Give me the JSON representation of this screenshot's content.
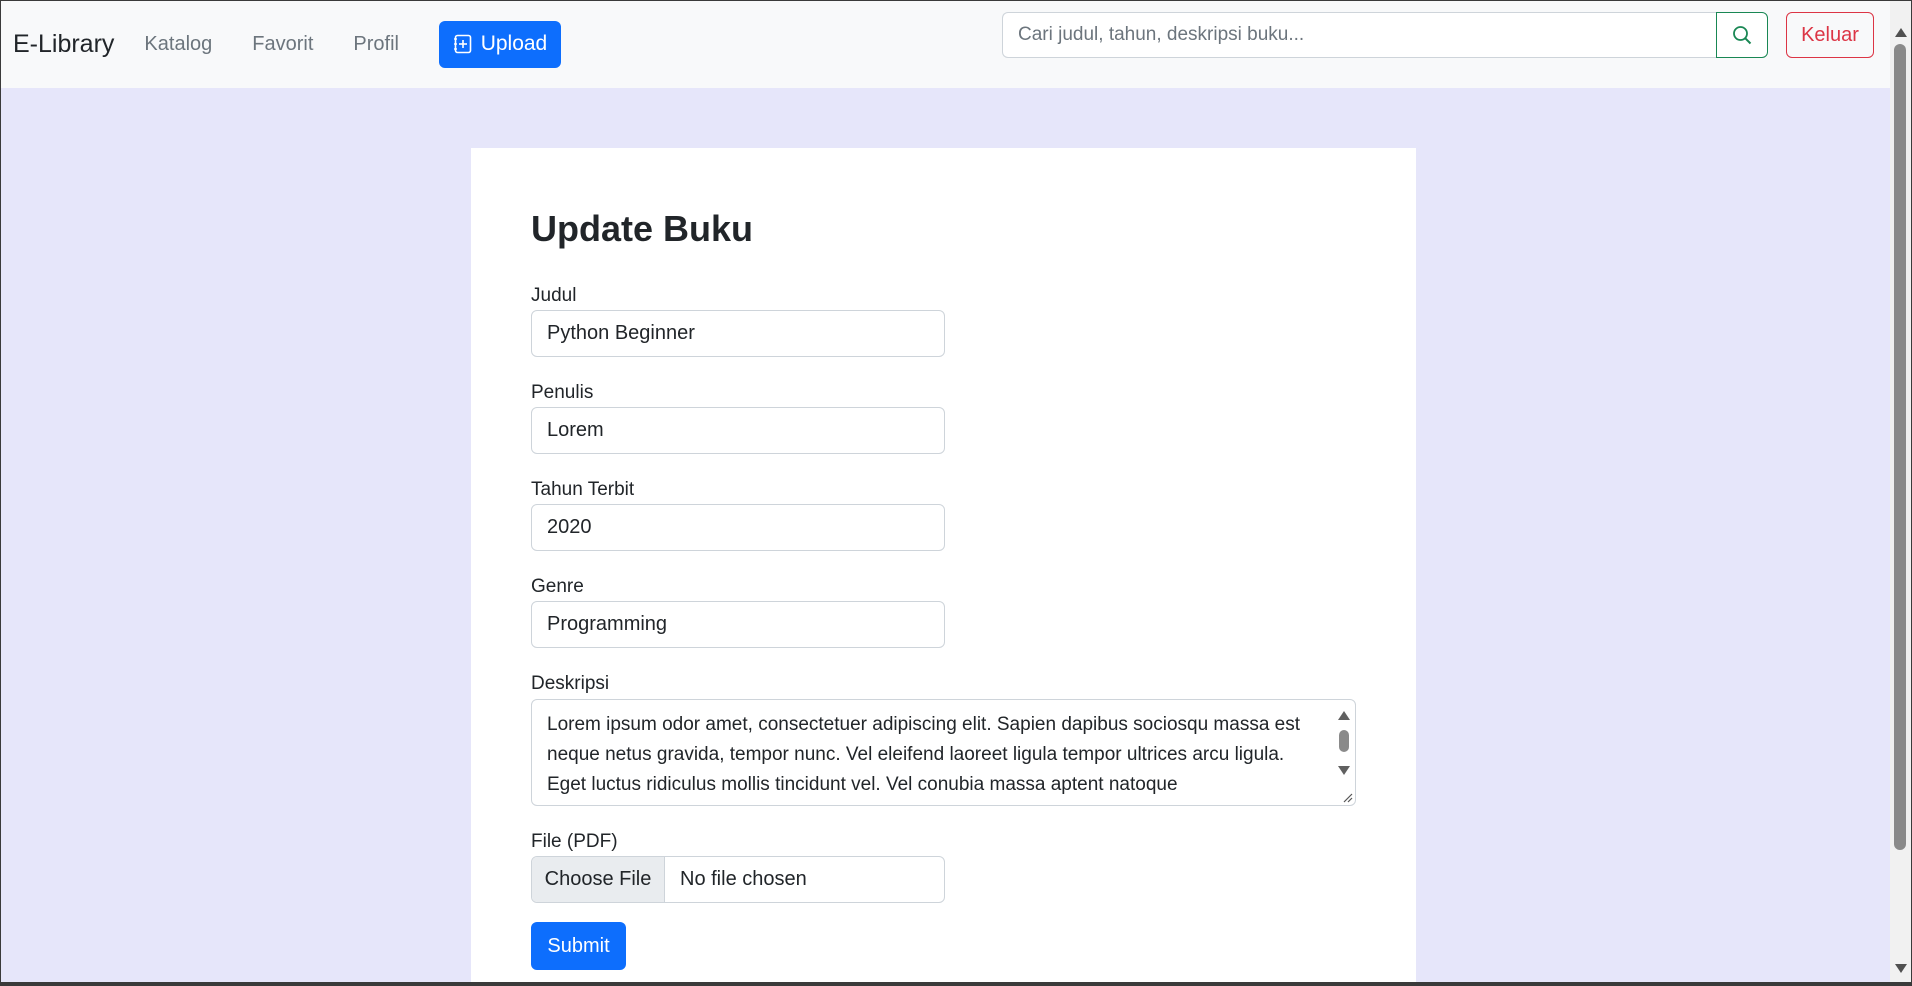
{
  "navbar": {
    "brand": "E-Library",
    "links": [
      "Katalog",
      "Favorit",
      "Profil"
    ],
    "upload_label": "Upload",
    "upload_icon": "file-plus-icon",
    "search_placeholder": "Cari judul, tahun, deskripsi buku...",
    "search_icon": "search-icon",
    "logout_label": "Keluar"
  },
  "form": {
    "title": "Update Buku",
    "fields": {
      "judul": {
        "label": "Judul",
        "value": "Python Beginner"
      },
      "penulis": {
        "label": "Penulis",
        "value": "Lorem"
      },
      "tahun": {
        "label": "Tahun Terbit",
        "value": "2020"
      },
      "genre": {
        "label": "Genre",
        "value": "Programming"
      }
    },
    "deskripsi": {
      "label": "Deskripsi",
      "value": "Lorem ipsum odor amet, consectetuer adipiscing elit. Sapien dapibus sociosqu massa est neque netus gravida, tempor nunc. Vel eleifend laoreet ligula tempor ultrices arcu ligula. Eget luctus ridiculus mollis tincidunt vel. Vel conubia massa aptent natoque"
    },
    "file": {
      "label": "File (PDF)",
      "button": "Choose File",
      "status": "No file chosen"
    },
    "submit_label": "Submit"
  },
  "colors": {
    "primary": "#0d6efd",
    "success": "#198754",
    "danger": "#dc3545",
    "page_bg": "#e6e6fa",
    "navbar_bg": "#f8f9fa"
  }
}
